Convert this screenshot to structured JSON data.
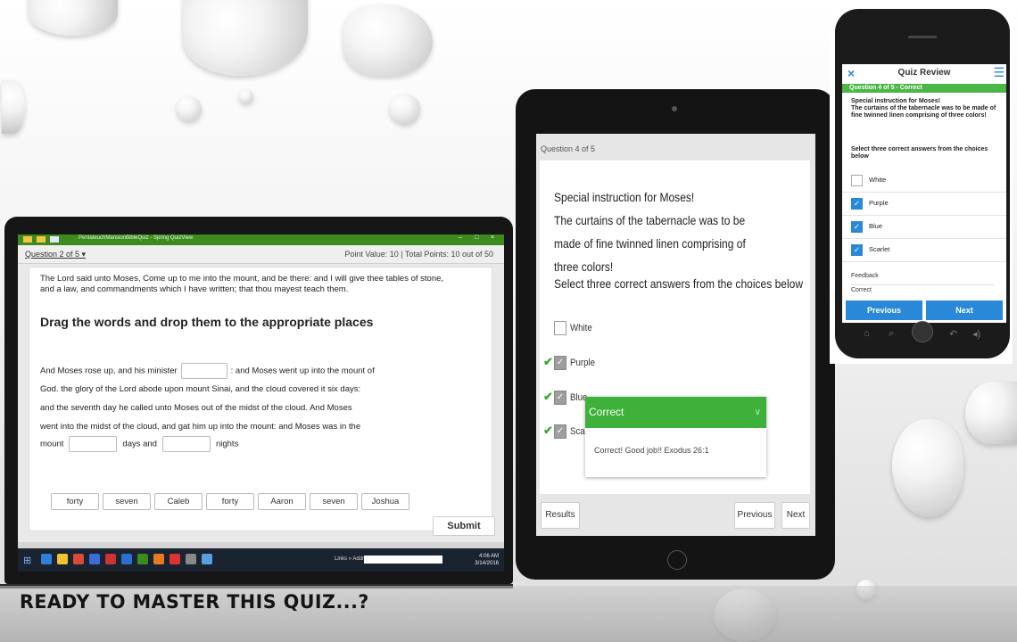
{
  "laptop": {
    "window_title": "PentateuchMansionBibleQuiz - Spring QuizView",
    "window_controls": [
      "–",
      "□",
      "×"
    ],
    "question_label": "Question 2 of 5 ▾",
    "points_label": "Point Value: 10  |  Total Points: 10 out of 50",
    "passage": "The Lord said unto Moses, Come up to me into the mount, and be there: and I will give thee tables of stone, and a law, and commandments which I have written; that thou mayest teach them.",
    "instruction": "Drag the words and drop them to the appropriate places",
    "para": {
      "line1_a": "And Moses rose up, and his minister",
      "line1_b": ": and Moses went up into the mount of",
      "line2": "God. the glory of the Lord abode upon mount Sinai, and the cloud covered it six days:",
      "line3": "and the seventh day he called unto Moses out of the midst of the cloud. And Moses",
      "line4": "went into the midst of the cloud, and gat him up into the mount: and Moses was in the",
      "line5_a": "mount",
      "line5_b": "days and",
      "line5_c": "nights"
    },
    "word_chips": [
      "forty",
      "seven",
      "Caleb",
      "forty",
      "Aaron",
      "seven",
      "Joshua"
    ],
    "submit_label": "Submit",
    "taskbar": {
      "links_label": "Links »  Address",
      "clock_time": "4:06 AM",
      "clock_date": "3/14/2016"
    }
  },
  "tablet": {
    "question_label": "Question 4 of 5",
    "prompt": "Special instruction for Moses!\nThe curtains of the tabernacle was to be made of fine twinned linen comprising of three colors!",
    "select_text": "Select three correct answers from the choices below",
    "options": [
      {
        "label": "White",
        "checked": false,
        "tick": false
      },
      {
        "label": "Purple",
        "checked": true,
        "tick": true
      },
      {
        "label": "Blue",
        "checked": true,
        "tick": true
      },
      {
        "label": "Scarlet",
        "checked": true,
        "tick": true
      }
    ],
    "popup": {
      "title": "Correct",
      "chevron": "∨",
      "body": "Correct! Good job!! Exodus 26:1"
    },
    "buttons": {
      "results": "Results",
      "previous": "Previous",
      "next": "Next"
    }
  },
  "phone": {
    "close_icon": "×",
    "title": "Quiz Review",
    "menu_icon": "☰",
    "status": "Question 4 of 5 - Correct",
    "prompt": "Special instruction for Moses!\nThe curtains of the tabernacle was to be made of fine twinned linen comprising of three colors!",
    "select_text": "Select three correct answers from the choices below",
    "options": [
      {
        "label": "White",
        "checked": false
      },
      {
        "label": "Purple",
        "checked": true
      },
      {
        "label": "Blue",
        "checked": true
      },
      {
        "label": "Scarlet",
        "checked": true
      }
    ],
    "feedback_label": "Feedback",
    "feedback_value": "Correct",
    "buttons": {
      "previous": "Previous",
      "next": "Next"
    },
    "accent_color": "#2a88d8",
    "status_color": "#4cb748"
  },
  "tagline": "READY TO MASTER THIS QUIZ...?"
}
